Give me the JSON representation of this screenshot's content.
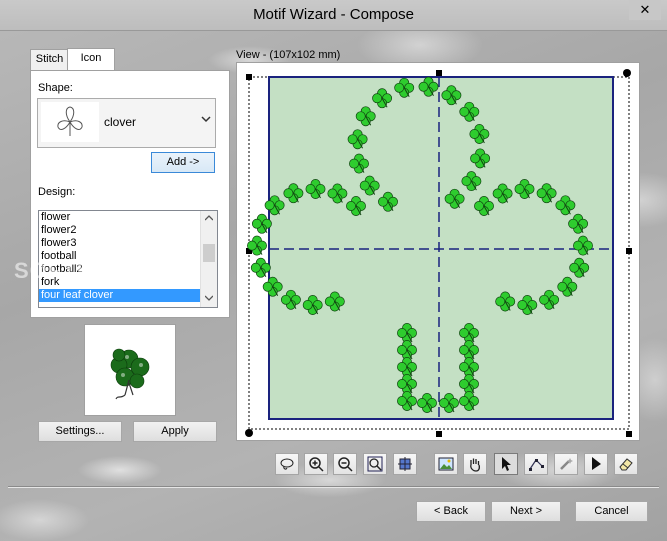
{
  "window": {
    "title": "Motif Wizard - Compose",
    "close_glyph": "✕"
  },
  "tabs": [
    {
      "label": "Stitch"
    },
    {
      "label": "Icon"
    }
  ],
  "icon_panel": {
    "shape_label": "Shape:",
    "shape_selected": "clover",
    "add_button": "Add ->",
    "design_label": "Design:",
    "design_items": [
      "flower",
      "flower2",
      "flower3",
      "football",
      "football2",
      "fork",
      "four leaf clover"
    ],
    "design_selected_index": 6
  },
  "buttons": {
    "settings": "Settings...",
    "apply": "Apply",
    "back": "< Back",
    "next": "Next >",
    "cancel": "Cancel"
  },
  "view": {
    "label": "View - (107x102 mm)"
  },
  "toolbar": {
    "tools": [
      "lasso-icon",
      "zoom-in-icon",
      "zoom-out-icon",
      "zoom-fit-icon",
      "zoom-selection-icon",
      "background-image-icon",
      "pan-hand-icon",
      "select-arrow-icon",
      "node-edit-icon",
      "wand-icon",
      "pointer-icon",
      "eraser-icon"
    ],
    "pressed_tool": "select-arrow-icon"
  },
  "colors": {
    "accent": "#3399ff",
    "canvas_fill": "#c4e0c4",
    "canvas_border": "#1a237e",
    "clover": "#2ecc2e"
  },
  "watermark": "SOFTPEDIA"
}
